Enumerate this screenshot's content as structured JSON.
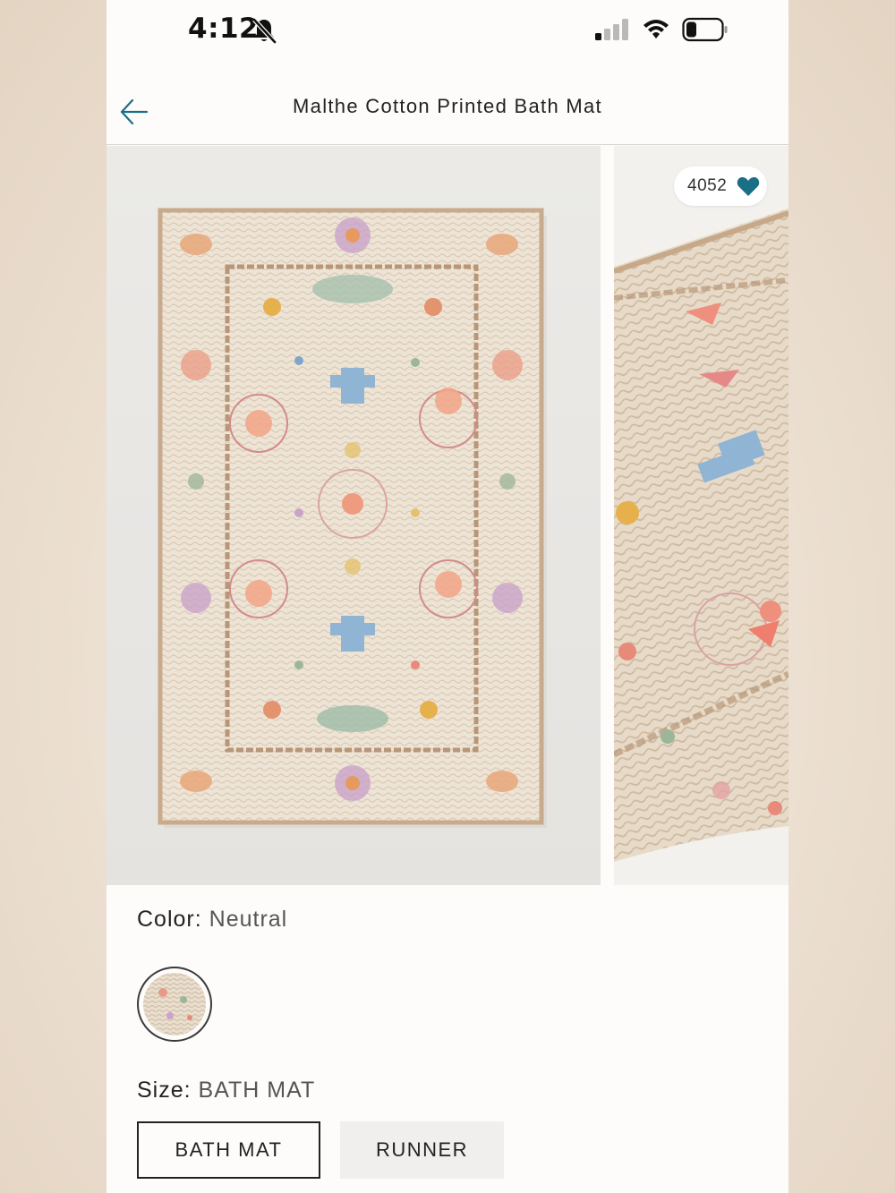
{
  "status_bar": {
    "time": "4:12"
  },
  "header": {
    "title": "Malthe Cotton Printed Bath Mat"
  },
  "gallery": {
    "likes": "4052"
  },
  "color": {
    "label": "Color:",
    "value": "Neutral"
  },
  "size": {
    "label": "Size:",
    "value": "BATH MAT",
    "options": [
      {
        "label": "BATH MAT",
        "selected": true
      },
      {
        "label": "RUNNER",
        "selected": false
      }
    ]
  },
  "colors": {
    "accent": "#1a6f86",
    "text": "#222222",
    "muted": "#555555"
  },
  "icons": [
    "bell-slash-icon",
    "signal-icon",
    "wifi-icon",
    "battery-icon",
    "back-arrow-icon",
    "heart-icon"
  ]
}
